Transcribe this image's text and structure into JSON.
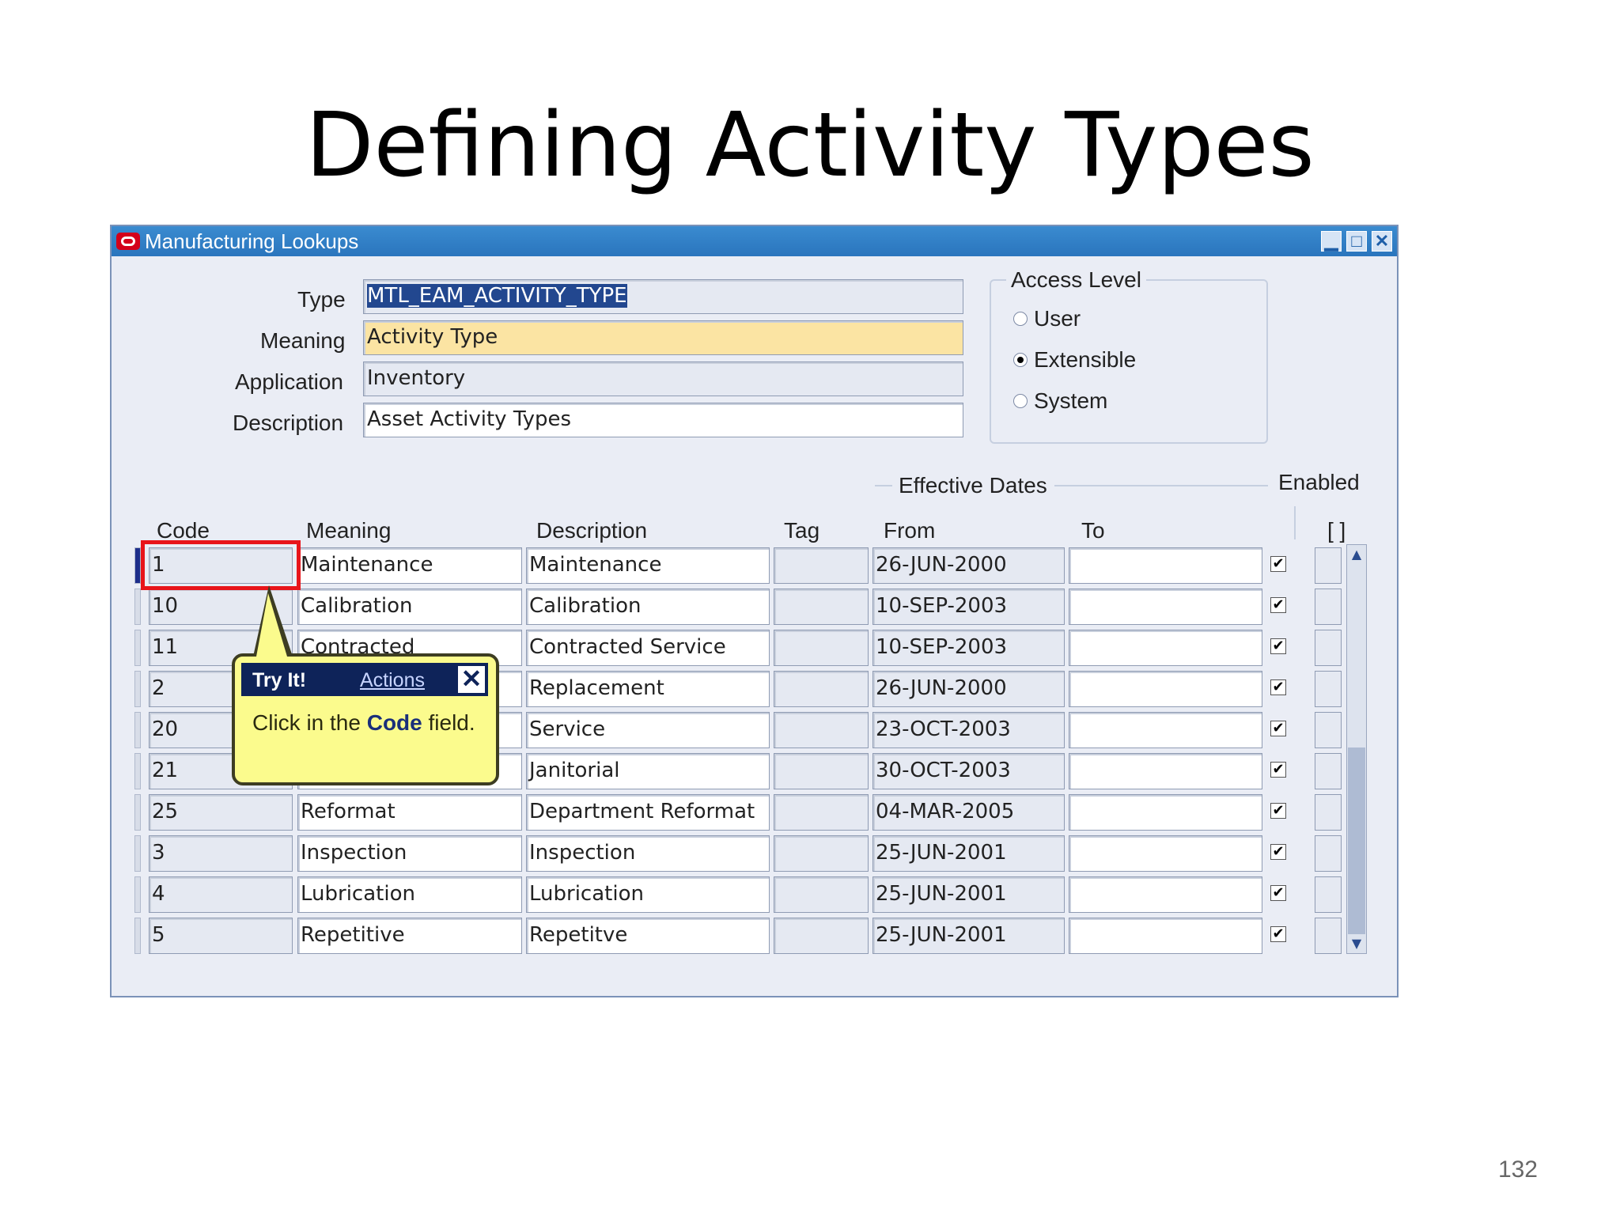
{
  "slide": {
    "title": "Defining Activity Types",
    "page_number": "132"
  },
  "window": {
    "title": "Manufacturing Lookups",
    "buttons": {
      "minimize": "▁",
      "maximize": "□",
      "close": "✕"
    }
  },
  "form": {
    "type_label": "Type",
    "type_value": "MTL_EAM_ACTIVITY_TYPE",
    "meaning_label": "Meaning",
    "meaning_value": "Activity Type",
    "application_label": "Application",
    "application_value": "Inventory",
    "description_label": "Description",
    "description_value": "Asset Activity Types"
  },
  "access_level": {
    "title": "Access Level",
    "options": [
      "User",
      "Extensible",
      "System"
    ],
    "selected": "Extensible"
  },
  "table": {
    "effective_dates_label": "Effective Dates",
    "enabled_label": "Enabled",
    "dff_label": "[ ]",
    "headers": {
      "code": "Code",
      "meaning": "Meaning",
      "description": "Description",
      "tag": "Tag",
      "from": "From",
      "to": "To"
    },
    "rows": [
      {
        "code": "1",
        "meaning": "Maintenance",
        "description": "Maintenance",
        "tag": "",
        "from": "26-JUN-2000",
        "to": "",
        "enabled": true
      },
      {
        "code": "10",
        "meaning": "Calibration",
        "description": "Calibration",
        "tag": "",
        "from": "10-SEP-2003",
        "to": "",
        "enabled": true
      },
      {
        "code": "11",
        "meaning": "Contracted",
        "description": "Contracted Service",
        "tag": "",
        "from": "10-SEP-2003",
        "to": "",
        "enabled": true
      },
      {
        "code": "2",
        "meaning": "",
        "description": "Replacement",
        "tag": "",
        "from": "26-JUN-2000",
        "to": "",
        "enabled": true
      },
      {
        "code": "20",
        "meaning": "",
        "description": "Service",
        "tag": "",
        "from": "23-OCT-2003",
        "to": "",
        "enabled": true
      },
      {
        "code": "21",
        "meaning": "",
        "description": "Janitorial",
        "tag": "",
        "from": "30-OCT-2003",
        "to": "",
        "enabled": true
      },
      {
        "code": "25",
        "meaning": "Reformat",
        "description": "Department Reformat",
        "tag": "",
        "from": "04-MAR-2005",
        "to": "",
        "enabled": true
      },
      {
        "code": "3",
        "meaning": "Inspection",
        "description": "Inspection",
        "tag": "",
        "from": "25-JUN-2001",
        "to": "",
        "enabled": true
      },
      {
        "code": "4",
        "meaning": "Lubrication",
        "description": "Lubrication",
        "tag": "",
        "from": "25-JUN-2001",
        "to": "",
        "enabled": true
      },
      {
        "code": "5",
        "meaning": "Repetitive",
        "description": "Repetitve",
        "tag": "",
        "from": "25-JUN-2001",
        "to": "",
        "enabled": true
      }
    ]
  },
  "tooltip": {
    "header_title": "Try It!",
    "actions_link": "Actions",
    "close": "✕",
    "body_prefix": "Click in the ",
    "body_bold": "Code",
    "body_suffix": " field."
  },
  "icons": {
    "checkbox": "checkbox-checked-icon",
    "scroll_up": "triangle-up-icon",
    "scroll_down": "triangle-down-icon"
  },
  "colors": {
    "highlight": "#e8141a",
    "tooltip_bg": "#fbfb8d",
    "titlebar": "#2a75bd",
    "required_field": "#fbe4a3"
  }
}
